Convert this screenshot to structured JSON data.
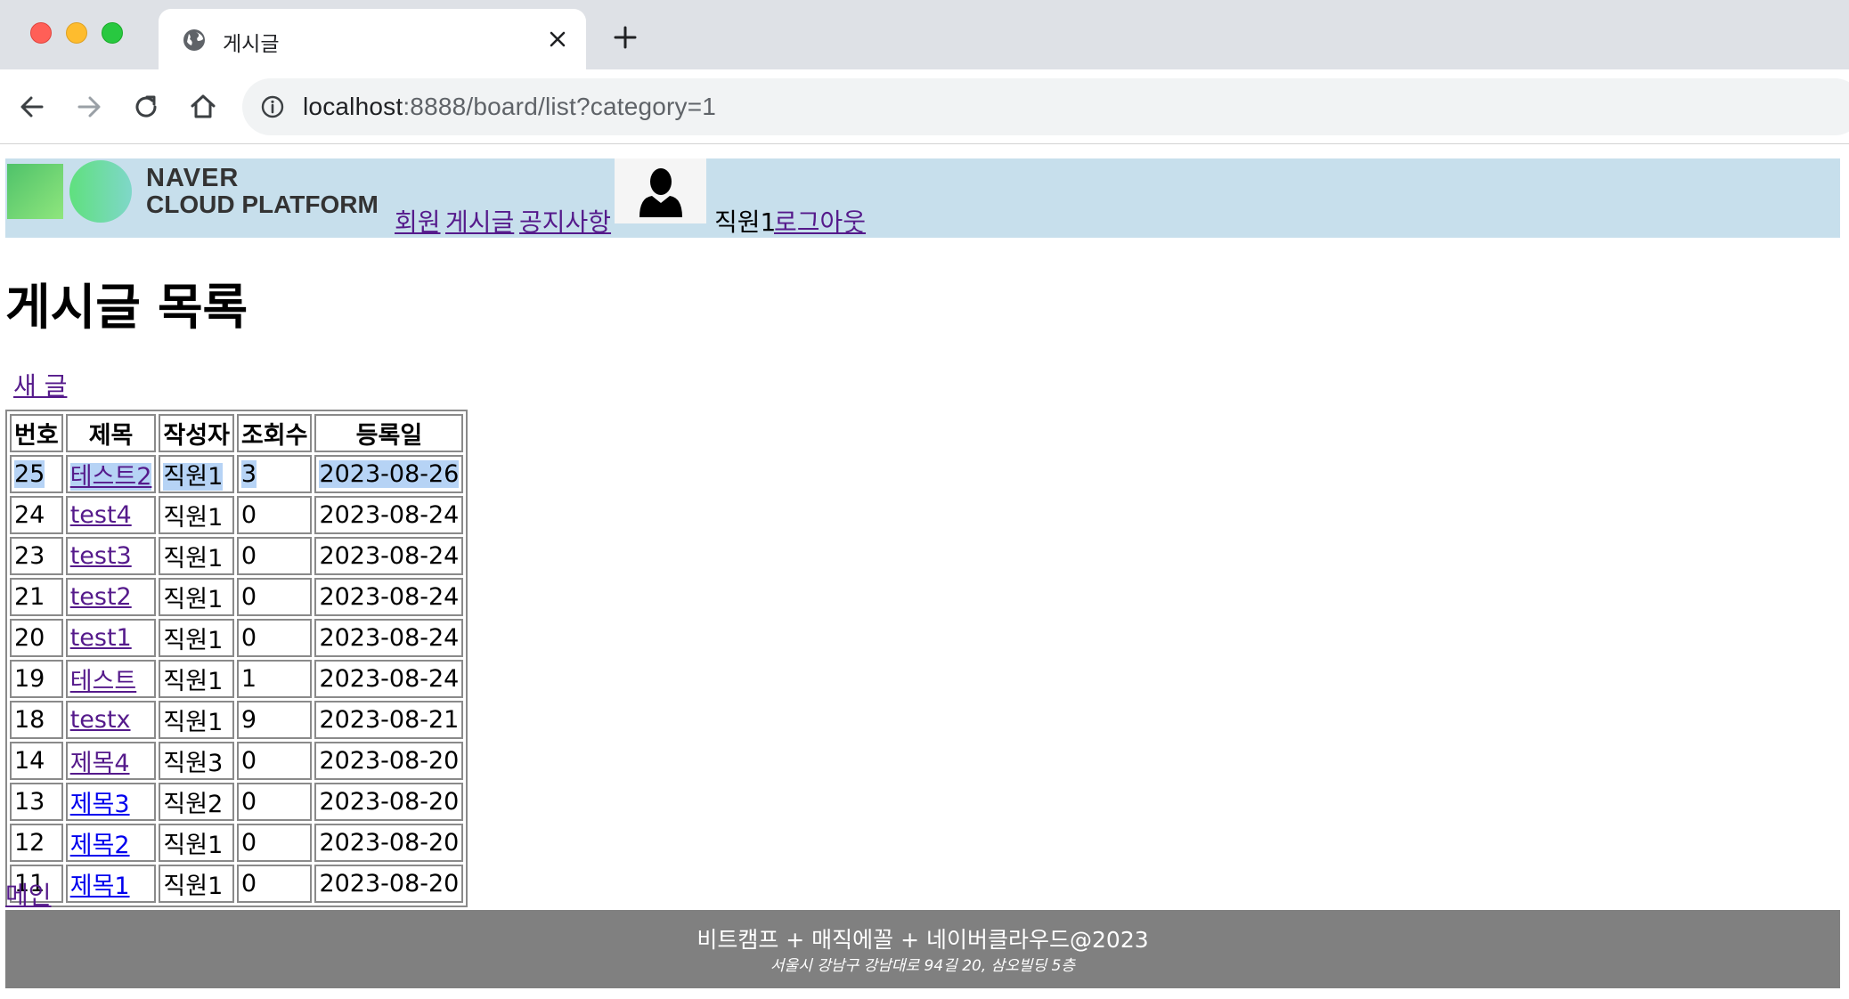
{
  "browser": {
    "tab_title": "게시글",
    "url_host": "localhost",
    "url_rest": ":8888/board/list?category=1",
    "icons": [
      "globe-icon",
      "close-icon",
      "plus-icon",
      "back-icon",
      "forward-icon",
      "reload-icon",
      "home-icon",
      "info-icon"
    ]
  },
  "header": {
    "logo_line1": "NAVER",
    "logo_line2": "CLOUD PLATFORM",
    "nav": [
      "회원",
      "게시글",
      "공지사항"
    ],
    "username": "직원1",
    "logout": "로그아웃"
  },
  "main": {
    "title": "게시글 목록",
    "new_post": "새 글",
    "columns": [
      "번호",
      "제목",
      "작성자",
      "조회수",
      "등록일"
    ],
    "rows": [
      {
        "no": "25",
        "title": "테스트2",
        "author": "직원1",
        "views": "3",
        "date": "2023-08-26",
        "selected": true
      },
      {
        "no": "24",
        "title": "test4",
        "author": "직원1",
        "views": "0",
        "date": "2023-08-24"
      },
      {
        "no": "23",
        "title": "test3",
        "author": "직원1",
        "views": "0",
        "date": "2023-08-24"
      },
      {
        "no": "21",
        "title": "test2",
        "author": "직원1",
        "views": "0",
        "date": "2023-08-24"
      },
      {
        "no": "20",
        "title": "test1",
        "author": "직원1",
        "views": "0",
        "date": "2023-08-24"
      },
      {
        "no": "19",
        "title": "테스트",
        "author": "직원1",
        "views": "1",
        "date": "2023-08-24"
      },
      {
        "no": "18",
        "title": "testx",
        "author": "직원1",
        "views": "9",
        "date": "2023-08-21"
      },
      {
        "no": "14",
        "title": "제목4",
        "author": "직원3",
        "views": "0",
        "date": "2023-08-20"
      },
      {
        "no": "13",
        "title": "제목3",
        "author": "직원2",
        "views": "0",
        "date": "2023-08-20",
        "unvisited": true
      },
      {
        "no": "12",
        "title": "제목2",
        "author": "직원1",
        "views": "0",
        "date": "2023-08-20",
        "unvisited": true
      },
      {
        "no": "11",
        "title": "제목1",
        "author": "직원1",
        "views": "0",
        "date": "2023-08-20",
        "unvisited": true
      }
    ],
    "main_link": "메인"
  },
  "footer": {
    "line1": "비트캠프 + 매직에꼴 + 네이버클라우드@2023",
    "line2": "서울시 강남구 강남대로 94길 20, 삼오빌딩 5층"
  },
  "colors": {
    "header_bg": "#c7dfec",
    "footer_bg": "#808080",
    "selection": "#b6d3f5",
    "visited_link": "#551a8b",
    "link": "#0000ee"
  }
}
